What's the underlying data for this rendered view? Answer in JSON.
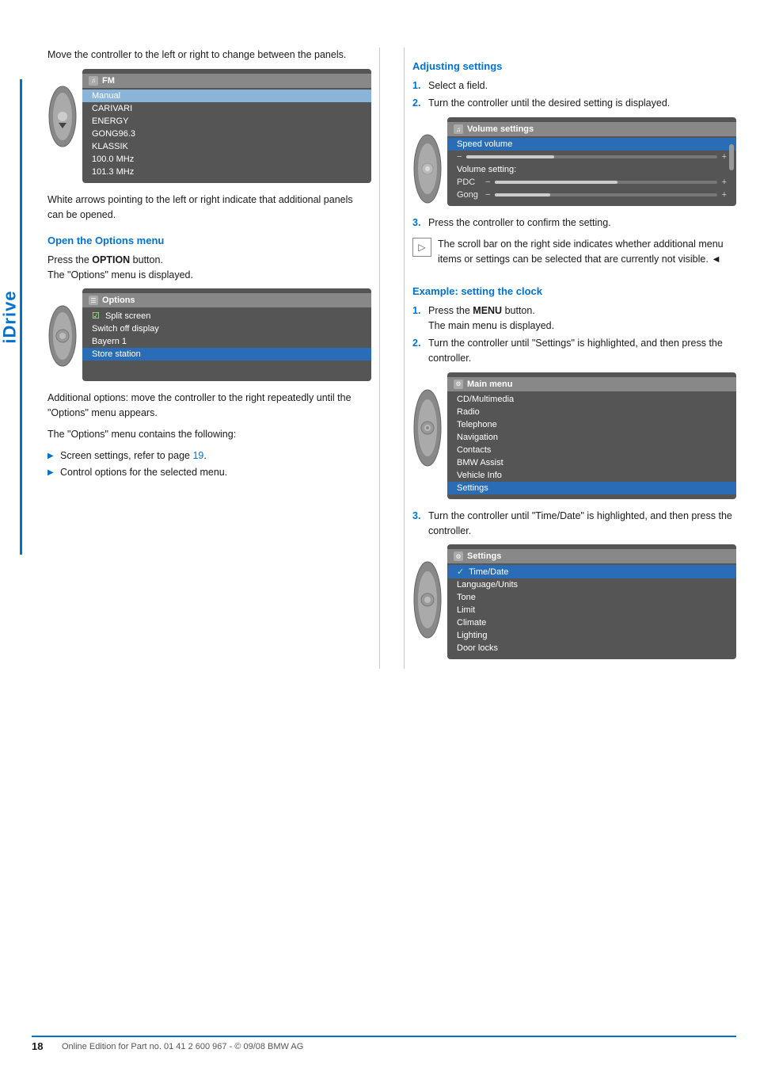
{
  "page": {
    "title": "iDrive",
    "page_number": "18",
    "footer_text": "Online Edition for Part no. 01 41 2 600 967  - © 09/08 BMW AG"
  },
  "left_column": {
    "intro_text": "Move the controller to the left or right to change between the panels.",
    "fm_screen": {
      "title": "FM",
      "rows": [
        "Manual",
        "CARIVARI",
        "ENERGY",
        "GONG96.3",
        "KLASSIK",
        "100.0 MHz",
        "101.3 MHz"
      ]
    },
    "arrows_note": "White arrows pointing to the left or right indicate that additional panels can be opened.",
    "open_options_heading": "Open the Options menu",
    "open_options_text1": "Press the ",
    "open_options_bold": "OPTION",
    "open_options_text2": " button.",
    "open_options_text3": "The \"Options\" menu is displayed.",
    "options_screen": {
      "title": "Options",
      "rows": [
        {
          "text": "Split screen",
          "type": "checkbox"
        },
        {
          "text": "Switch off display",
          "type": "normal"
        },
        {
          "text": "Bayern 1",
          "type": "normal"
        },
        {
          "text": "Store station",
          "type": "highlighted"
        }
      ]
    },
    "additional_options_text": "Additional options: move the controller to the right repeatedly until the \"Options\" menu appears.",
    "contains_text": "The \"Options\" menu contains the following:",
    "bullet_items": [
      {
        "text": "Screen settings, refer to page ",
        "link": "19",
        "suffix": "."
      },
      {
        "text": "Control options for the selected menu."
      }
    ]
  },
  "right_column": {
    "adjusting_settings_heading": "Adjusting settings",
    "adjusting_steps": [
      {
        "num": "1.",
        "text": "Select a field."
      },
      {
        "num": "2.",
        "text": "Turn the controller until the desired setting is displayed."
      }
    ],
    "volume_screen": {
      "title": "Volume settings",
      "speed_volume_label": "Speed volume",
      "volume_setting_label": "Volume setting:",
      "pdc_label": "PDC",
      "gong_label": "Gong"
    },
    "step3_text": "Press the controller to confirm the setting.",
    "scroll_note": "The scroll bar on the right side indicates whether additional menu items or settings can be selected that are currently not visible.",
    "triangle_suffix": "◄",
    "example_heading": "Example: setting the clock",
    "example_steps": [
      {
        "num": "1.",
        "text_before": "Press the ",
        "bold": "MENU",
        "text_after": " button.\nThe main menu is displayed."
      },
      {
        "num": "2.",
        "text": "Turn the controller until \"Settings\" is highlighted, and then press the controller."
      }
    ],
    "main_menu_screen": {
      "title": "Main menu",
      "rows": [
        {
          "text": "CD/Multimedia",
          "type": "normal"
        },
        {
          "text": "Radio",
          "type": "normal"
        },
        {
          "text": "Telephone",
          "type": "normal"
        },
        {
          "text": "Navigation",
          "type": "normal"
        },
        {
          "text": "Contacts",
          "type": "normal"
        },
        {
          "text": "BMW Assist",
          "type": "normal"
        },
        {
          "text": "Vehicle Info",
          "type": "normal"
        },
        {
          "text": "Settings",
          "type": "highlighted"
        }
      ]
    },
    "step3_clock_text": "Turn the controller until \"Time/Date\" is highlighted, and then press the controller.",
    "settings_screen": {
      "title": "Settings",
      "rows": [
        {
          "text": "Time/Date",
          "type": "highlighted",
          "check": true
        },
        {
          "text": "Language/Units",
          "type": "normal"
        },
        {
          "text": "Tone",
          "type": "normal"
        },
        {
          "text": "Limit",
          "type": "normal"
        },
        {
          "text": "Climate",
          "type": "normal"
        },
        {
          "text": "Lighting",
          "type": "normal"
        },
        {
          "text": "Door locks",
          "type": "normal"
        }
      ]
    }
  }
}
